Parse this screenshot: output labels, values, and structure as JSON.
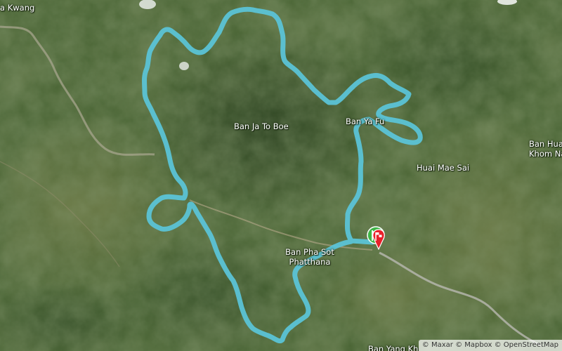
{
  "map": {
    "imagery": "satellite",
    "route_color": "#5bc3d6",
    "start_marker_color": "#3fb548",
    "finish_marker_color": "#e8202a",
    "markers": [
      {
        "name": "start-marker",
        "icon": "flag-icon",
        "color": "#3fb548"
      },
      {
        "name": "finish-marker",
        "icon": "checkered-flag-icon",
        "color": "#e8202a"
      }
    ]
  },
  "places": {
    "kwang": "a Kwang",
    "ja_to_boe": "Ban Ja To Boe",
    "ya_fu": "Ban Ya Fu",
    "huai_mae_sai": "Huai Mae Sai",
    "hua_khom_line1": "Ban Hua",
    "hua_khom_line2": "Khom Na",
    "pha_sot_line1": "Ban Pha Sot",
    "pha_sot_line2": "Phatthana",
    "bottom_partial": "Ban Yang Kh"
  },
  "attribution": {
    "maxar": "© Maxar",
    "mapbox": "© Mapbox",
    "osm": "© OpenStreetMap"
  }
}
